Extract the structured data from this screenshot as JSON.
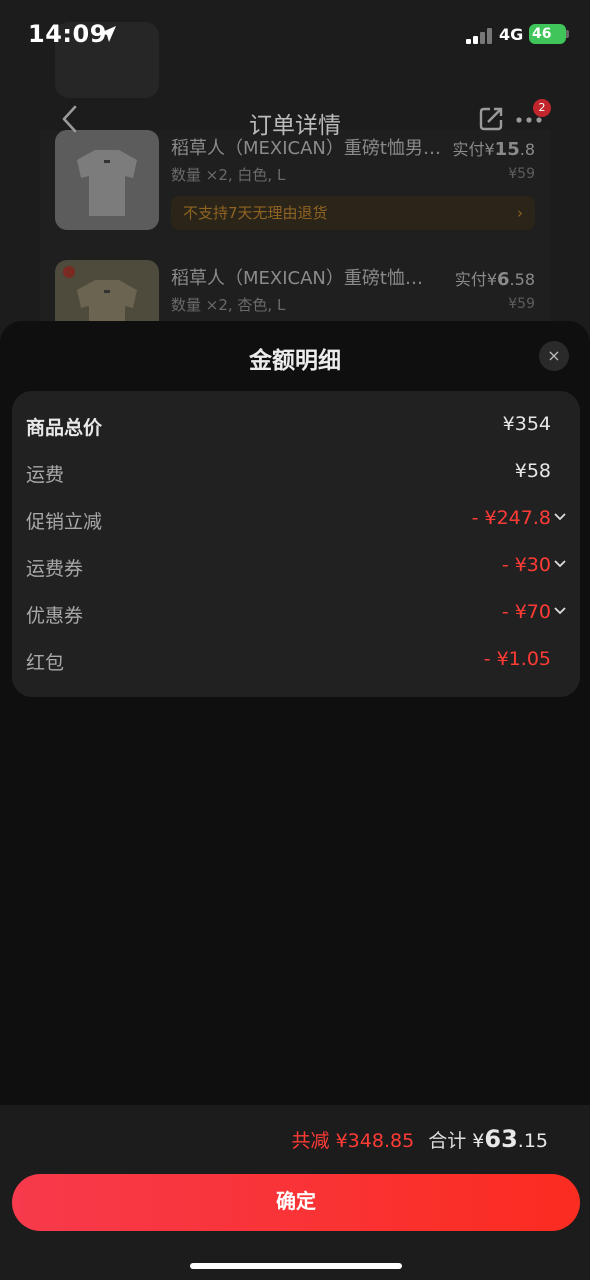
{
  "status_bar": {
    "time": "14:09",
    "network": "4G",
    "battery": "46"
  },
  "nav": {
    "title": "订单详情",
    "badge": "2"
  },
  "products": [
    {
      "name": "稻草人（MEXICAN）重磅t恤男…",
      "spec": "数量 ×2, 白色, L",
      "paid_prefix": "实付¥",
      "paid_int": "15",
      "paid_dec": ".8",
      "original": "¥59",
      "return_note": "不支持7天无理由退货"
    },
    {
      "name": "稻草人（MEXICAN）重磅t恤…",
      "spec": "数量 ×2, 杏色, L",
      "paid_prefix": "实付¥",
      "paid_int": "6",
      "paid_dec": ".58",
      "original": "¥59"
    }
  ],
  "sheet": {
    "title": "金额明细",
    "close": "×",
    "rows": [
      {
        "label": "商品总价",
        "value": "¥354"
      },
      {
        "label": "运费",
        "value": "¥58"
      },
      {
        "label": "促销立减",
        "value": "- ¥247.8"
      },
      {
        "label": "运费券",
        "value": "- ¥30"
      },
      {
        "label": "优惠券",
        "value": "- ¥70"
      },
      {
        "label": "红包",
        "value": "- ¥1.05"
      }
    ]
  },
  "footer": {
    "reduce_label": "共减",
    "reduce_amount": "¥348.85",
    "total_label": "合计",
    "total_prefix": "¥",
    "total_int": "63",
    "total_dec": ".15",
    "confirm_label": "确定"
  },
  "colors": {
    "accent": "#ff3b36",
    "button_start": "#f73a4c",
    "button_end": "#fb2c20",
    "battery": "#3fc55a"
  }
}
